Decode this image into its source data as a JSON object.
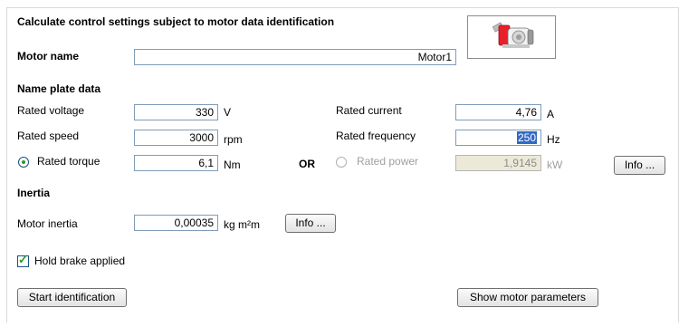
{
  "title": "Calculate control settings subject to motor data identification",
  "motor_name": {
    "label": "Motor name",
    "value": "Motor1"
  },
  "nameplate": {
    "heading": "Name plate data",
    "rated_voltage": {
      "label": "Rated voltage",
      "value": "330",
      "unit": "V"
    },
    "rated_speed": {
      "label": "Rated speed",
      "value": "3000",
      "unit": "rpm"
    },
    "rated_torque": {
      "label": "Rated torque",
      "value": "6,1",
      "unit": "Nm",
      "selected": true
    },
    "or_label": "OR",
    "rated_current": {
      "label": "Rated current",
      "value": "4,76",
      "unit": "A"
    },
    "rated_frequency": {
      "label": "Rated frequency",
      "value": "250",
      "unit": "Hz"
    },
    "rated_power": {
      "label": "Rated power",
      "value": "1,9145",
      "unit": "kW",
      "selected": false
    },
    "info_button": "Info ..."
  },
  "inertia": {
    "heading": "Inertia",
    "motor_inertia": {
      "label": "Motor inertia",
      "value": "0,00035",
      "unit": "kg m²m"
    },
    "info_button": "Info ..."
  },
  "hold_brake": {
    "label": "Hold brake applied",
    "checked": true
  },
  "buttons": {
    "start_identification": "Start identification",
    "show_motor_parameters": "Show motor parameters"
  },
  "icons": {
    "motor": "motor-icon"
  },
  "colors": {
    "motor_red": "#e8202a",
    "radio_green": "#21a121",
    "field_border": "#7f9db9"
  }
}
